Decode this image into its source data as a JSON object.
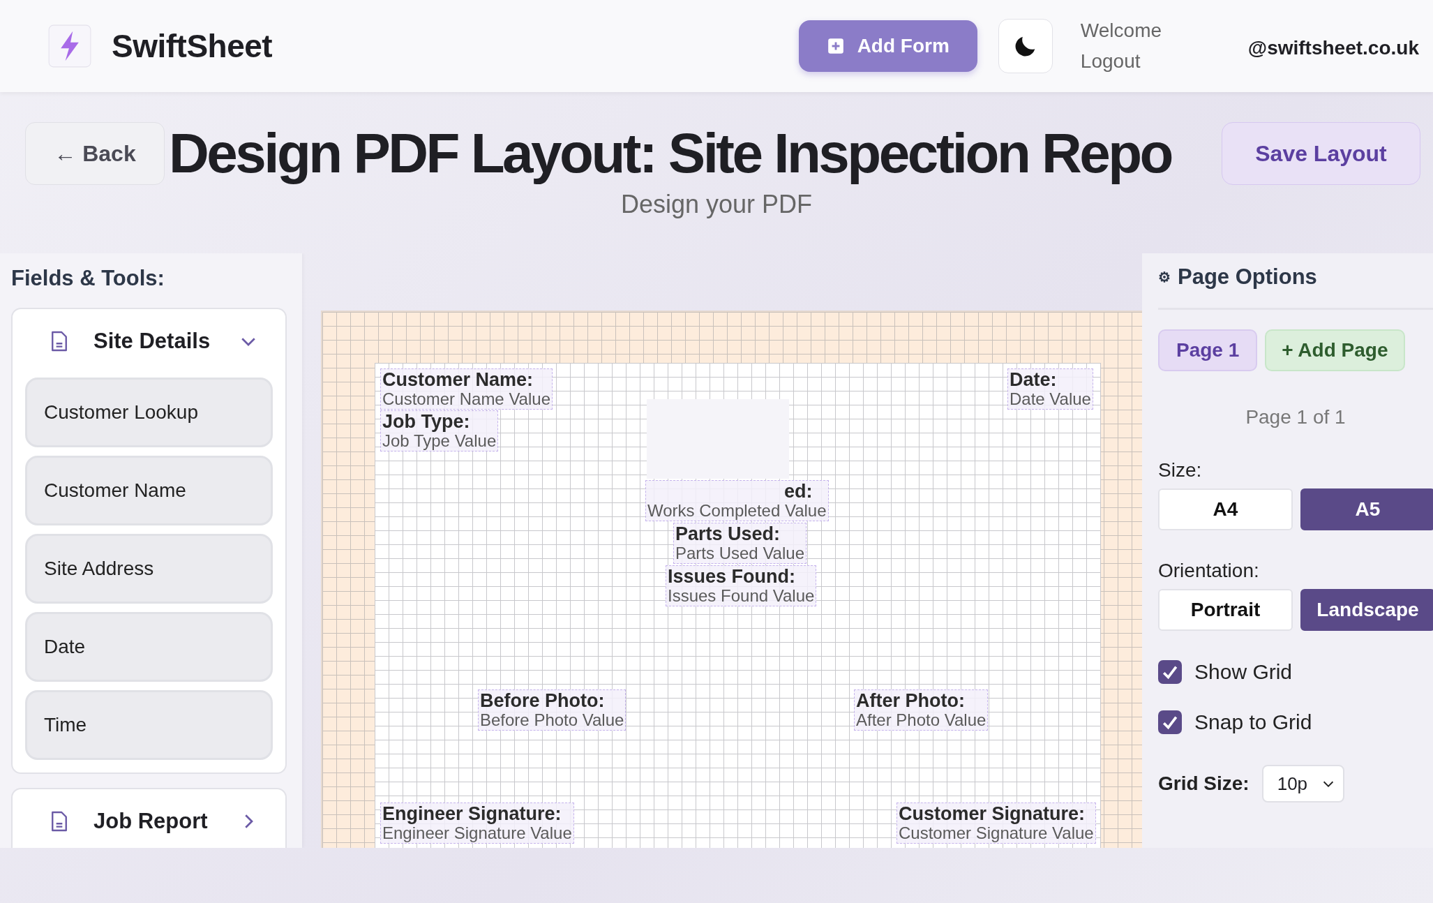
{
  "header": {
    "app_name": "SwiftSheet",
    "add_form_button": "Add Form",
    "welcome": "Welcome",
    "logout": "Logout",
    "email": "@swiftsheet.co.uk"
  },
  "title_bar": {
    "back_button": "← Back",
    "title": "Design PDF Layout: Site Inspection Repo",
    "subtitle": "Design your PDF",
    "save_button": "Save Layout"
  },
  "sidebar": {
    "heading": "Fields & Tools:",
    "sections": [
      {
        "title": "Site Details",
        "expanded": true,
        "items": [
          "Customer Lookup",
          "Customer Name",
          "Site Address",
          "Date",
          "Time"
        ]
      },
      {
        "title": "Job Report",
        "expanded": false
      }
    ]
  },
  "canvas": {
    "fields": [
      {
        "label": "Customer Name:",
        "value": "Customer Name Value"
      },
      {
        "label": "Job Type:",
        "value": "Job Type Value"
      },
      {
        "label": "Date:",
        "value": "Date Value"
      },
      {
        "label": "ed:",
        "value": "Works Completed Value"
      },
      {
        "label": "Parts Used:",
        "value": "Parts Used Value"
      },
      {
        "label": "Issues Found:",
        "value": "Issues Found Value"
      },
      {
        "label": "Before Photo:",
        "value": "Before Photo Value"
      },
      {
        "label": "After Photo:",
        "value": "After Photo Value"
      },
      {
        "label": "Engineer Signature:",
        "value": "Engineer Signature Value"
      },
      {
        "label": "Customer Signature:",
        "value": "Customer Signature Value"
      }
    ]
  },
  "page_options": {
    "icon": "⚙",
    "title": "Page Options",
    "pages": [
      {
        "label": "Page 1",
        "selected": true
      }
    ],
    "add_page_button": "+ Add Page",
    "page_count": "Page 1 of 1",
    "size_label": "Size:",
    "sizes": [
      {
        "label": "A4",
        "selected": false
      },
      {
        "label": "A5",
        "selected": true
      }
    ],
    "orientation_label": "Orientation:",
    "orientations": [
      {
        "label": "Portrait",
        "selected": false
      },
      {
        "label": "Landscape",
        "selected": true
      }
    ],
    "toggles": [
      {
        "label": "Show Grid",
        "checked": true
      },
      {
        "label": "Snap to Grid",
        "checked": true
      }
    ],
    "grid_size_label": "Grid Size:",
    "grid_size_value": "10p"
  }
}
